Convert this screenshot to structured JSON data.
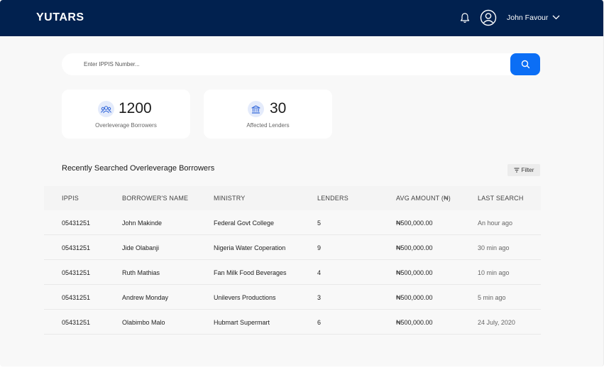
{
  "header": {
    "brand": "YUTARS",
    "user_name": "John Favour"
  },
  "search": {
    "placeholder": "Enter IPPIS Number..."
  },
  "stats": [
    {
      "value": "1200",
      "label": "Overleverage Borrowers",
      "icon": "users-group-icon"
    },
    {
      "value": "30",
      "label": "Affected Lenders",
      "icon": "bank-icon"
    }
  ],
  "section": {
    "title": "Recently Searched Overleverage Borrowers",
    "filter_label": "Filter"
  },
  "table": {
    "columns": [
      "IPPIS",
      "BORROWER'S NAME",
      "MINISTRY",
      "LENDERS",
      "AVG AMOUNT (₦)",
      "LAST SEARCH"
    ],
    "rows": [
      [
        "05431251",
        "John Makinde",
        "Federal Govt College",
        "5",
        "₦500,000.00",
        "An hour ago"
      ],
      [
        "05431251",
        "Jide Olabanji",
        "Nigeria Water Coperation",
        "9",
        "₦500,000.00",
        "30 min ago"
      ],
      [
        "05431251",
        "Ruth Mathias",
        "Fan Milk Food Beverages",
        "4",
        "₦500,000.00",
        "10 min ago"
      ],
      [
        "05431251",
        "Andrew Monday",
        "Unilevers Productions",
        "3",
        "₦500,000.00",
        "5 min ago"
      ],
      [
        "05431251",
        "Olabimbo Malo",
        "Hubmart Supermart",
        "6",
        "₦500,000.00",
        "24 July, 2020"
      ]
    ]
  },
  "colors": {
    "topbar": "#01214f",
    "accent": "#0b6ef5",
    "background": "#f8f8f8"
  }
}
